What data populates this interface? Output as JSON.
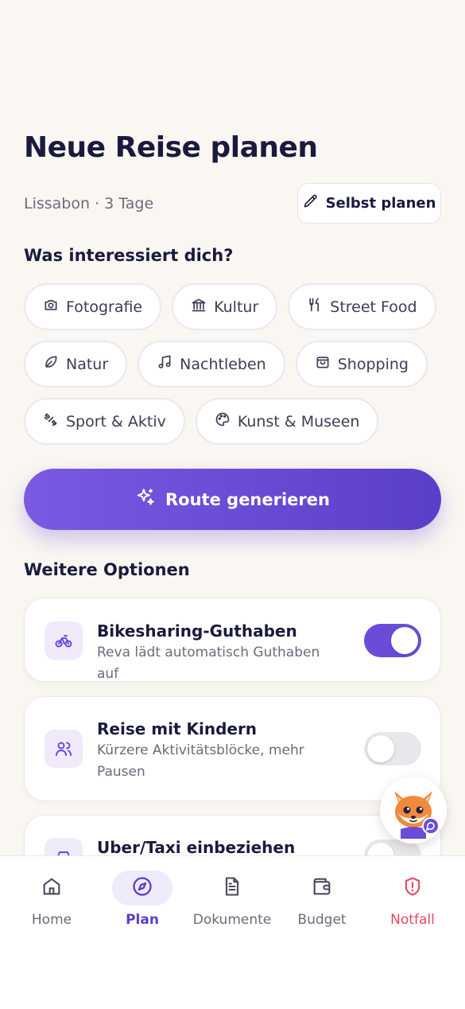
{
  "header": {
    "title": "Neue Reise planen",
    "subtitle": "Lissabon · 3 Tage",
    "self_plan_label": "Selbst planen"
  },
  "interests": {
    "heading": "Was interessiert dich?",
    "chips": [
      {
        "label": "Fotografie",
        "icon": "camera-icon"
      },
      {
        "label": "Kultur",
        "icon": "museum-icon"
      },
      {
        "label": "Street Food",
        "icon": "utensils-icon"
      },
      {
        "label": "Natur",
        "icon": "leaf-icon"
      },
      {
        "label": "Nachtleben",
        "icon": "music-note-icon"
      },
      {
        "label": "Shopping",
        "icon": "shopping-bag-icon"
      },
      {
        "label": "Sport & Aktiv",
        "icon": "dumbbell-icon"
      },
      {
        "label": "Kunst & Museen",
        "icon": "palette-icon"
      }
    ]
  },
  "generate_button": {
    "label": "Route generieren",
    "icon": "sparkles-icon"
  },
  "options": {
    "heading": "Weitere Optionen",
    "items": [
      {
        "title": "Bikesharing-Guthaben",
        "description": "Reva lädt automatisch Guthaben auf",
        "enabled": true,
        "icon": "bike-icon"
      },
      {
        "title": "Reise mit Kindern",
        "description": "Kürzere Aktivitätsblöcke, mehr Pausen",
        "enabled": false,
        "icon": "users-icon"
      },
      {
        "title": "Uber/Taxi einbeziehen",
        "description": "",
        "enabled": false,
        "icon": "car-icon"
      }
    ]
  },
  "mascot": {
    "icon": "fox-mascot-icon"
  },
  "tabbar": {
    "tabs": [
      {
        "label": "Home",
        "icon": "home-icon",
        "active": false
      },
      {
        "label": "Plan",
        "icon": "compass-icon",
        "active": true
      },
      {
        "label": "Dokumente",
        "icon": "document-icon",
        "active": false
      },
      {
        "label": "Budget",
        "icon": "wallet-icon",
        "active": false
      },
      {
        "label": "Notfall",
        "icon": "shield-alert-icon",
        "active": false
      }
    ]
  },
  "colors": {
    "accent": "#6a4cd9",
    "background": "#faf7f2",
    "danger": "#e04c5f"
  }
}
